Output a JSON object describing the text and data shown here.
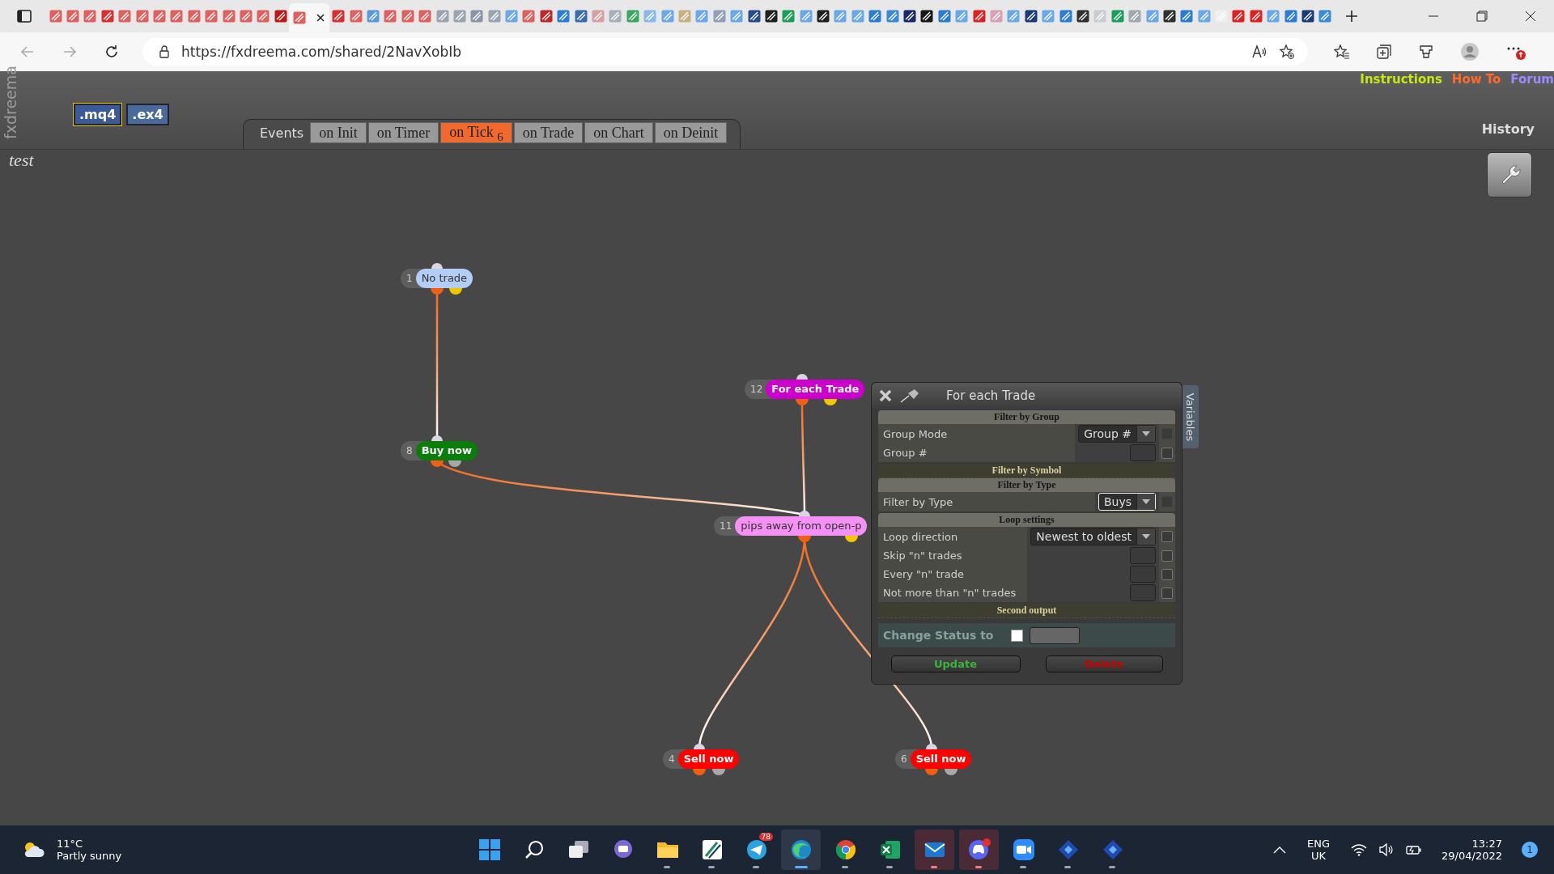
{
  "browser": {
    "tabs": [
      {
        "selected": false,
        "color": "#e06060"
      },
      {
        "selected": false,
        "color": "#e06060"
      },
      {
        "selected": false,
        "color": "#e06060"
      },
      {
        "selected": false,
        "color": "#d83030"
      },
      {
        "selected": false,
        "color": "#e06060"
      },
      {
        "selected": false,
        "color": "#e06060"
      },
      {
        "selected": false,
        "color": "#e06060"
      },
      {
        "selected": false,
        "color": "#e06060"
      },
      {
        "selected": false,
        "color": "#e06060"
      },
      {
        "selected": false,
        "color": "#e06060"
      },
      {
        "selected": false,
        "color": "#e06060"
      },
      {
        "selected": false,
        "color": "#e06060"
      },
      {
        "selected": false,
        "color": "#e06060"
      },
      {
        "selected": false,
        "color": "#c01818"
      },
      {
        "selected": true,
        "color": "#e06060"
      },
      {
        "selected": false,
        "color": "#d83030"
      },
      {
        "selected": false,
        "color": "#e06060"
      },
      {
        "selected": false,
        "color": "#5a9ad8"
      },
      {
        "selected": false,
        "color": "#e06060"
      },
      {
        "selected": false,
        "color": "#e06060"
      },
      {
        "selected": false,
        "color": "#e06060"
      },
      {
        "selected": false,
        "color": "#9aa4b0"
      },
      {
        "selected": false,
        "color": "#9aa4b0"
      },
      {
        "selected": false,
        "color": "#8a96a8"
      },
      {
        "selected": false,
        "color": "#9aa4b0"
      },
      {
        "selected": false,
        "color": "#6aa8e8"
      },
      {
        "selected": false,
        "color": "#e06060"
      },
      {
        "selected": false,
        "color": "#c02828"
      },
      {
        "selected": false,
        "color": "#2b7cd3"
      },
      {
        "selected": false,
        "color": "#3a6ab0"
      },
      {
        "selected": false,
        "color": "#d8a0a0"
      },
      {
        "selected": false,
        "color": "#a8b0b8"
      },
      {
        "selected": false,
        "color": "#3aa860"
      },
      {
        "selected": false,
        "color": "#8ab8e8"
      },
      {
        "selected": false,
        "color": "#6aa8e8"
      },
      {
        "selected": false,
        "color": "#c8b080"
      },
      {
        "selected": false,
        "color": "#6aa8e8"
      },
      {
        "selected": false,
        "color": "#90a0b8"
      },
      {
        "selected": false,
        "color": "#6aa8e8"
      },
      {
        "selected": false,
        "color": "#2a4a88"
      },
      {
        "selected": false,
        "color": "#202020"
      },
      {
        "selected": false,
        "color": "#1a9e5a"
      },
      {
        "selected": false,
        "color": "#6aa8e8"
      },
      {
        "selected": false,
        "color": "#202020"
      },
      {
        "selected": false,
        "color": "#6aa8e8"
      },
      {
        "selected": false,
        "color": "#6aa8e8"
      },
      {
        "selected": false,
        "color": "#2b7cd3"
      },
      {
        "selected": false,
        "color": "#3a8ad8"
      },
      {
        "selected": false,
        "color": "#1a2a68"
      },
      {
        "selected": false,
        "color": "#181818"
      },
      {
        "selected": false,
        "color": "#2b7cd3"
      },
      {
        "selected": false,
        "color": "#6aa8e8"
      },
      {
        "selected": false,
        "color": "#e02020"
      },
      {
        "selected": false,
        "color": "#d8a0b0"
      },
      {
        "selected": false,
        "color": "#6aa8e8"
      },
      {
        "selected": false,
        "color": "#1a3a78"
      },
      {
        "selected": false,
        "color": "#6aa8e8"
      },
      {
        "selected": false,
        "color": "#2b7cd3"
      },
      {
        "selected": false,
        "color": "#303030"
      },
      {
        "selected": false,
        "color": "#c8ccd0"
      },
      {
        "selected": false,
        "color": "#1a9e5a"
      },
      {
        "selected": false,
        "color": "#a0a8b0"
      },
      {
        "selected": false,
        "color": "#6aa8e8"
      },
      {
        "selected": false,
        "color": "#303030"
      },
      {
        "selected": false,
        "color": "#2b7cd3"
      },
      {
        "selected": false,
        "color": "#6aa8e8"
      },
      {
        "selected": false,
        "color": "#f0f0f0"
      },
      {
        "selected": false,
        "color": "#e02020"
      },
      {
        "selected": false,
        "color": "#e02020"
      },
      {
        "selected": false,
        "color": "#6aa8e8"
      },
      {
        "selected": false,
        "color": "#2b7cd3"
      },
      {
        "selected": false,
        "color": "#1a3a78"
      },
      {
        "selected": false,
        "color": "#3a8ad8"
      }
    ],
    "address": "https://fxdreema.com/shared/2NavXobIb"
  },
  "app": {
    "brand": "fxdreema",
    "export_buttons": [
      ".mq4",
      ".ex4"
    ],
    "events_label": "Events",
    "event_tabs": [
      {
        "label": "on Init",
        "selected": false
      },
      {
        "label": "on Timer",
        "selected": false
      },
      {
        "label": "on Tick $_{6}$",
        "selected": true
      },
      {
        "label": "on Trade",
        "selected": false
      },
      {
        "label": "on Chart",
        "selected": false
      },
      {
        "label": "on Deinit",
        "selected": false
      }
    ],
    "links": [
      {
        "label": "Instructions",
        "color": "#c8e614"
      },
      {
        "label": "How To",
        "color": "#ff6a2a"
      },
      {
        "label": "Forum",
        "color": "#9a8cff"
      }
    ],
    "history": "History",
    "project_name": "test",
    "nodes": [
      {
        "number": "1",
        "label": "No trade",
        "kind": "condition",
        "color": "#b4cdf5"
      },
      {
        "number": "12",
        "label": "For each Trade",
        "kind": "loop",
        "color": "#cc00cc"
      },
      {
        "number": "8",
        "label": "Buy now",
        "kind": "action",
        "color": "#0a7d0a"
      },
      {
        "number": "11",
        "label": "pips away from open-p",
        "kind": "condition",
        "color": "#f590f5"
      },
      {
        "number": "4",
        "label": "Sell now",
        "kind": "action",
        "color": "#ff0000"
      },
      {
        "number": "6",
        "label": "Sell now",
        "kind": "action",
        "color": "#ff0000"
      }
    ],
    "dialog": {
      "title": "For each Trade",
      "sections": [
        {
          "heading": "Filter by Group",
          "kind": "subsection",
          "rows": [
            {
              "label": "Group Mode",
              "kind": "select",
              "value": "Group #",
              "focused": false,
              "checked": false,
              "disabled": true
            },
            {
              "label": "Group #",
              "kind": "field",
              "checked": false,
              "disabled": false
            }
          ]
        },
        {
          "heading": "Filter by Symbol",
          "kind": "section"
        },
        {
          "heading": "Filter by Type",
          "kind": "subsection",
          "rows": [
            {
              "label": "Filter by Type",
              "kind": "select",
              "value": "Buys",
              "focused": true,
              "checked": false,
              "disabled": true
            }
          ]
        },
        {
          "heading": "Loop settings",
          "kind": "subsection",
          "rows": [
            {
              "label": "Loop direction",
              "kind": "select",
              "value": "Newest to oldest",
              "focused": false,
              "checked": false,
              "disabled": false
            },
            {
              "label": "Skip \"n\" trades",
              "kind": "field",
              "checked": false,
              "disabled": false
            },
            {
              "label": "Every \"n\" trade",
              "kind": "field",
              "checked": false,
              "disabled": false
            },
            {
              "label": "Not more than \"n\" trades",
              "kind": "field",
              "checked": false,
              "disabled": false
            }
          ]
        },
        {
          "heading": "Second output",
          "kind": "section"
        }
      ],
      "status": {
        "label": "Change Status to",
        "checked": false
      },
      "buttons": [
        {
          "label": "Update",
          "kind": "update"
        },
        {
          "label": "Delete",
          "kind": "delete"
        }
      ]
    },
    "variables_tab": "Variables"
  },
  "taskbar": {
    "weather": {
      "temperature": "11°C",
      "condition": "Partly sunny"
    },
    "apps": [
      {
        "running": false,
        "selected": false,
        "attention": false
      },
      {
        "running": false,
        "selected": false,
        "attention": false
      },
      {
        "running": false,
        "selected": false,
        "attention": false
      },
      {
        "running": false,
        "selected": false,
        "attention": false
      },
      {
        "running": true,
        "selected": false,
        "attention": false
      },
      {
        "running": true,
        "selected": false,
        "attention": false
      },
      {
        "running": true,
        "selected": false,
        "attention": false,
        "badge": "78"
      },
      {
        "running": true,
        "selected": true,
        "attention": false
      },
      {
        "running": true,
        "selected": false,
        "attention": false
      },
      {
        "running": true,
        "selected": false,
        "attention": false
      },
      {
        "running": true,
        "selected": false,
        "attention": true
      },
      {
        "running": true,
        "selected": false,
        "attention": true
      },
      {
        "running": true,
        "selected": false,
        "attention": false
      },
      {
        "running": true,
        "selected": false,
        "attention": false
      },
      {
        "running": true,
        "selected": false,
        "attention": false
      }
    ],
    "language": "ENG",
    "region": "UK",
    "time": "13:27",
    "date": "29/04/2022",
    "notifications": "1"
  }
}
